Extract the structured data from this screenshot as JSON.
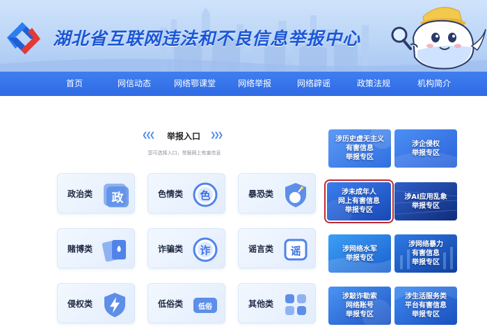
{
  "header": {
    "site_title": "湖北省互联网违法和不良信息举报中心"
  },
  "nav": {
    "items": [
      "首页",
      "网信动态",
      "网络鄂课堂",
      "网络举报",
      "网络辟谣",
      "政策法规",
      "机构简介"
    ]
  },
  "report_entry": {
    "title": "举报入口",
    "subtitle": "您可选择入口，举报网上有害信息"
  },
  "categories": [
    {
      "label": "政治类",
      "icon_glyph": "政",
      "icon": "zheng-icon"
    },
    {
      "label": "色情类",
      "icon_glyph": "色",
      "icon": "se-icon"
    },
    {
      "label": "暴恐类",
      "icon_glyph": "",
      "icon": "shield-bomb-icon"
    },
    {
      "label": "赌博类",
      "icon_glyph": "",
      "icon": "playing-cards-icon"
    },
    {
      "label": "诈骗类",
      "icon_glyph": "诈",
      "icon": "zha-icon"
    },
    {
      "label": "谣言类",
      "icon_glyph": "谣",
      "icon": "yao-icon"
    },
    {
      "label": "侵权类",
      "icon_glyph": "",
      "icon": "lightning-shield-icon"
    },
    {
      "label": "低俗类",
      "icon_glyph": "低俗",
      "icon": "disu-icon"
    },
    {
      "label": "其他类",
      "icon_glyph": "",
      "icon": "grid-icon"
    }
  ],
  "zones": [
    {
      "label": "涉历史虚无主义\n有害信息\n举报专区",
      "highlighted": false
    },
    {
      "label": "涉企侵权\n举报专区",
      "highlighted": false
    },
    {
      "label": "涉未成年人\n网上有害信息\n举报专区",
      "highlighted": true
    },
    {
      "label": "涉AI应用乱象\n举报专区",
      "highlighted": false
    },
    {
      "label": "涉网络水军\n举报专区",
      "highlighted": false
    },
    {
      "label": "涉网络暴力\n有害信息\n举报专区",
      "highlighted": false
    },
    {
      "label": "涉敲诈勒索\n网络账号\n举报专区",
      "highlighted": false
    },
    {
      "label": "涉生活服务类\n平台有害信息\n举报专区",
      "highlighted": false
    }
  ],
  "colors": {
    "primary": "#2f6be4",
    "title_blue": "#1b56d6",
    "highlight_border": "#c0282d"
  }
}
